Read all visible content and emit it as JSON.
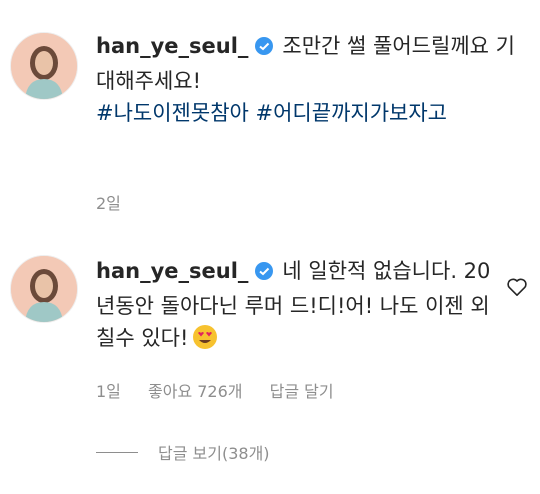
{
  "comments": [
    {
      "username": "han_ye_seul_",
      "text": "조만간 썰 풀어드릴께요 기대해주세요!",
      "hashtags": "#나도이젠못참아 #어디끝까지가보자고",
      "time": "2일"
    },
    {
      "username": "han_ye_seul_",
      "text": "네 일한적 없습니다. 20년동안 돌아다닌 루머 드!디!어! 나도 이젠 외칠수 있다!",
      "emoji": "heart-eyes-emoji",
      "time": "1일",
      "likes": "좋아요 726개",
      "reply": "답글 달기"
    }
  ],
  "view_replies": "답글 보기(38개)",
  "colors": {
    "hashtag": "#00376b",
    "verified": "#3897f0",
    "meta": "#8e8e8e"
  }
}
